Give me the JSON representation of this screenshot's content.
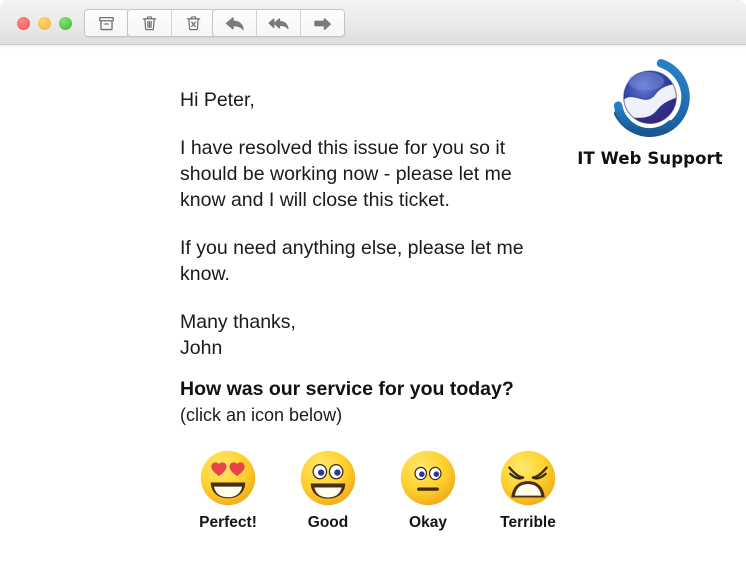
{
  "window": {
    "traffic_lights": [
      {
        "name": "close",
        "color": "#f86158"
      },
      {
        "name": "minimize",
        "color": "#f6bb42"
      },
      {
        "name": "maximize",
        "color": "#4dc441"
      }
    ]
  },
  "toolbar": {
    "groups": [
      {
        "name": "archive-group",
        "buttons": [
          {
            "name": "archive-button",
            "icon": "archive-box-icon",
            "label": "Archive"
          }
        ]
      },
      {
        "name": "delete-group",
        "buttons": [
          {
            "name": "delete-button",
            "icon": "trash-can-icon",
            "label": "Delete"
          },
          {
            "name": "junk-button",
            "icon": "trash-can-x-icon",
            "label": "Junk"
          }
        ]
      },
      {
        "name": "navigation-group",
        "buttons": [
          {
            "name": "reply-button",
            "icon": "reply-arrow-icon",
            "label": "Reply"
          },
          {
            "name": "reply-all-button",
            "icon": "reply-all-arrow-icon",
            "label": "Reply All"
          },
          {
            "name": "forward-button",
            "icon": "forward-arrow-icon",
            "label": "Forward"
          }
        ]
      }
    ]
  },
  "message": {
    "greeting": "Hi Peter,",
    "paragraph_1": "I have resolved this issue for you so it should be working now - please let me know and I will close this ticket.",
    "paragraph_2": "If you need anything else, please let me know.",
    "closing": "Many thanks,",
    "sender": "John"
  },
  "logo": {
    "name": "it-web-support-logo",
    "text": "IT Web Support",
    "colors": {
      "ring": "#1f6fb5",
      "sphere_outer": "#2b3f9e",
      "sphere_inner": "#4b5fc4",
      "swoosh": "#ffffff",
      "deep": "#3a2a7a"
    }
  },
  "survey": {
    "title": "How was our service for you today?",
    "subtitle": "(click an icon below)",
    "options": [
      {
        "name": "rating-perfect",
        "label": "Perfect!",
        "icon": "heart-eyes-face-icon",
        "value": "perfect"
      },
      {
        "name": "rating-good",
        "label": "Good",
        "icon": "grinning-face-icon",
        "value": "good"
      },
      {
        "name": "rating-okay",
        "label": "Okay",
        "icon": "neutral-face-icon",
        "value": "okay"
      },
      {
        "name": "rating-terrible",
        "label": "Terrible",
        "icon": "weary-face-icon",
        "value": "terrible"
      }
    ],
    "emoji_colors": {
      "face_light": "#ffdd4a",
      "face_dark": "#f5b41c",
      "feature_dark": "#3f2a12",
      "heart": "#e8434a",
      "eye_white": "#ffffff",
      "pupil": "#2a3b8f",
      "mouth_white": "#fdfdf2"
    }
  }
}
